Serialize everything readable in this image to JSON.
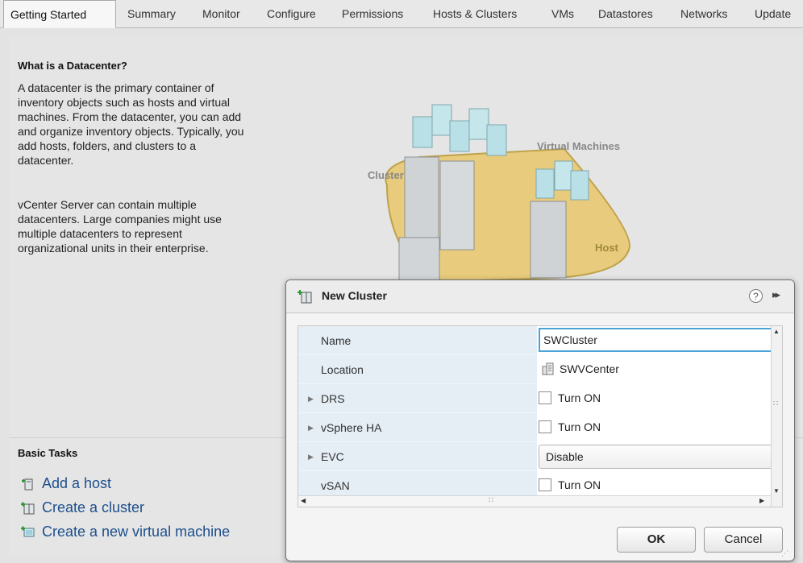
{
  "tabs": [
    "Getting Started",
    "Summary",
    "Monitor",
    "Configure",
    "Permissions",
    "Hosts & Clusters",
    "VMs",
    "Datastores",
    "Networks",
    "Update"
  ],
  "active_tab": "Getting Started",
  "about": {
    "title": "What is a Datacenter?",
    "paragraph1": [
      "A datacenter is the primary container of",
      "inventory objects such as hosts and virtual",
      "machines. From the datacenter, you can add",
      "and organize inventory objects. Typically, you",
      "add hosts, folders, and clusters to a",
      "datacenter."
    ],
    "paragraph2": [
      "vCenter Server can contain multiple",
      "datacenters. Large companies might use",
      "multiple datacenters to represent",
      "organizational units in their enterprise."
    ]
  },
  "illustration": {
    "cluster_label": "Cluster",
    "vm_label": "Virtual Machines",
    "host_label": "Host"
  },
  "basic_tasks": {
    "title": "Basic Tasks",
    "items": [
      "Add a host",
      "Create a cluster",
      "Create a new virtual machine"
    ]
  },
  "dialog": {
    "title": "New Cluster",
    "help_icon": "?",
    "expand_icon": "▸▸",
    "rows": {
      "name": {
        "label": "Name",
        "value": "SWCluster"
      },
      "location": {
        "label": "Location",
        "value": "SWVCenter"
      },
      "drs": {
        "label": "DRS",
        "option": "Turn ON"
      },
      "vsphere_ha": {
        "label": "vSphere HA",
        "option": "Turn ON"
      },
      "evc": {
        "label": "EVC",
        "value": "Disable"
      },
      "vsan": {
        "label": "vSAN",
        "option": "Turn ON"
      }
    },
    "ok_label": "OK",
    "cancel_label": "Cancel"
  },
  "colors": {
    "accent": "#4aa3d6",
    "link": "#1c4f8c",
    "row_label_bg": "#e5eef5"
  }
}
